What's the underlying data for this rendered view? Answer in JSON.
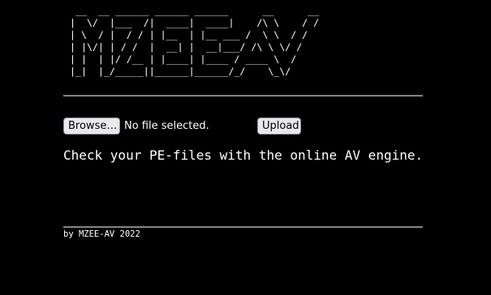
{
  "logo": {
    "ascii_art": " __  __ ______ ______ ______      __      __\n|  \\/  |___  /|  ____|  ____|    /\\ \\    / /\n| \\  / |  / / | |__  | |__ ___ /  \\ \\  / / \n| |\\/| | / /  |  __| |  __|___/ /\\ \\ \\/ /  \n| |  | |/ /__ | |____| |____ / ____ \\  /   \n|_|  |_/_____||______|______/_/    \\_\\/    ",
    "text": "MZEE-AV"
  },
  "upload_form": {
    "browse_label": "Browse…",
    "file_status": "No file selected.",
    "upload_label": "Upload"
  },
  "tagline": "Check your PE-files with the online AV engine.",
  "footer": {
    "credit": "by MZEE-AV 2022"
  },
  "colors": {
    "background": "#000000",
    "text": "#ffffff",
    "rule": "#8a8a8a",
    "button_bg": "#e9e9ed"
  }
}
